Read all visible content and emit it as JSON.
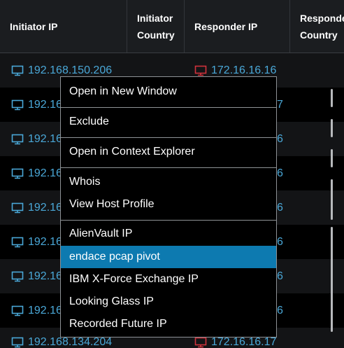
{
  "table": {
    "headers": [
      {
        "line1": "Initiator IP",
        "line2": ""
      },
      {
        "line1": "Initiator",
        "line2": "Country"
      },
      {
        "line1": "Responder IP",
        "line2": ""
      },
      {
        "line1": "Responder",
        "line2": "Country"
      }
    ],
    "rows": [
      {
        "initiator_ip": "192.168.150.206",
        "responder_ip": "172.16.16.16"
      },
      {
        "initiator_ip": "192.16",
        "responder_ip": "7"
      },
      {
        "initiator_ip": "192.16",
        "responder_ip": "6"
      },
      {
        "initiator_ip": "192.16",
        "responder_ip": "6"
      },
      {
        "initiator_ip": "192.16",
        "responder_ip": "6"
      },
      {
        "initiator_ip": "192.16",
        "responder_ip": "6"
      },
      {
        "initiator_ip": "192.16",
        "responder_ip": "6"
      },
      {
        "initiator_ip": "192.16",
        "responder_ip": "6"
      },
      {
        "initiator_ip": "192.168.134.204",
        "responder_ip": "172.16.16.17"
      }
    ]
  },
  "context_menu": {
    "items": [
      {
        "label": "Open in New Window"
      },
      {
        "label": "Exclude"
      },
      {
        "label": "Open in Context Explorer"
      },
      {
        "label": "Whois"
      },
      {
        "label": "View Host Profile"
      },
      {
        "label": "AlienVault IP"
      },
      {
        "label": "endace pcap pivot",
        "active": true
      },
      {
        "label": "IBM X-Force Exchange IP"
      },
      {
        "label": "Looking Glass IP"
      },
      {
        "label": "Recorded Future IP"
      }
    ]
  },
  "colors": {
    "link": "#4aa8d8",
    "host_red": "#d0323c",
    "menu_highlight": "#0d7ab0",
    "header_bg": "#1b1d20"
  }
}
